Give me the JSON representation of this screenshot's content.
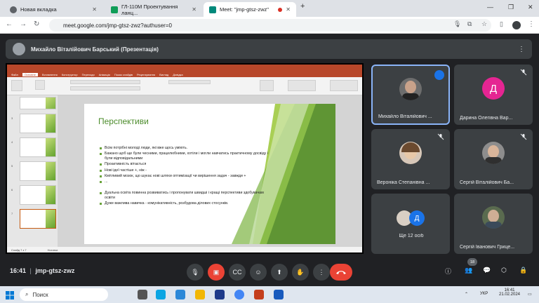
{
  "browser": {
    "tabs": [
      {
        "title": "Новая вкладка",
        "icon_color": "#5f6368"
      },
      {
        "title": "ГЛ-110М Проектування ланц...",
        "icon_color": "#0f9d58"
      },
      {
        "title": "Meet: \"jmp-gtsz-zwz\"",
        "icon_color": "#00897b"
      }
    ],
    "address": "meet.google.com/jmp-gtsz-zwz?authuser=0"
  },
  "presenter": {
    "label": "Михайло Віталійович Барський (Презентація)"
  },
  "ppt": {
    "menu": [
      "Файл",
      "Основне",
      "Вставлення",
      "Конструктор",
      "Переходи",
      "Анімація",
      "Показ слайдів",
      "Рецензування",
      "Вигляд",
      "Довідка"
    ],
    "status_slide": "Слайд 7 з 7",
    "status_notes": "Нотатки",
    "slide_title": "Перспективи",
    "bullets_group1": [
      "Всім потрібні молоді люди, які вже щось уміють.",
      "Бажано щоб ще були чесними, працелюбними, хотіли і могли навчатись практичному досвіду і були відповідальними",
      "Проактивність вітається",
      "Нові ідеї частіше +, ніж -",
      "Кмітливий мозок, що шукає нові шляхи оптимізації чи вирішення задач - завжди +",
      "..."
    ],
    "bullets_group2": [
      "Дуальна освіта повинна розвиватись і пропонувати швидші і кращі перспективи здобувачам освіти",
      "Дуже важлива навичка - комунікативність, розбудова ділових стосунків."
    ]
  },
  "participants": [
    {
      "name": "Михайло Віталійович ...",
      "kind": "photo",
      "speaking": true
    },
    {
      "name": "Дарина Олегівна Вар...",
      "kind": "letter",
      "letter": "Д",
      "color": "#e52592"
    },
    {
      "name": "Вероніка Степанівна ...",
      "kind": "photo"
    },
    {
      "name": "Сергій Віталійович Ба...",
      "kind": "photo"
    },
    {
      "name": "Ще 12 осіб",
      "kind": "group",
      "letter": "Д"
    },
    {
      "name": "Сергій Іванович Грице...",
      "kind": "photo"
    }
  ],
  "meeting": {
    "time": "16:41",
    "code": "jmp-gtsz-zwz",
    "people_count": "18"
  },
  "taskbar": {
    "search": "Поиск",
    "lang": "УКР",
    "time": "16:41",
    "date": "21.02.2024"
  }
}
